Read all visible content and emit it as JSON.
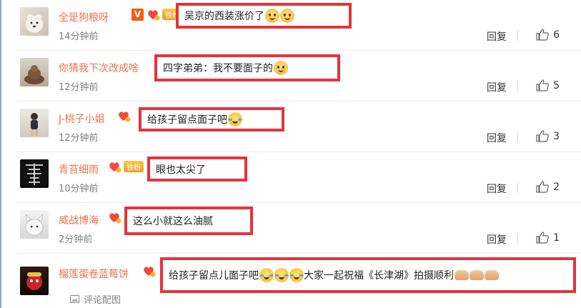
{
  "ui": {
    "reply_label": "回复",
    "comment_with_pic_label": "评论配图",
    "accent_name_color": "#eb7350",
    "highlight_color": "#e5333b"
  },
  "comments": [
    {
      "name": "全是狗粮呀",
      "badges": [
        "V",
        "heart",
        "铁粉"
      ],
      "time": "14分钟前",
      "text": "吴京的西装涨价了",
      "emojis": [
        "shy",
        "shy"
      ],
      "likes": "6"
    },
    {
      "name": "你猜我下次改成啥",
      "badges": [],
      "time": "12分钟前",
      "text": "四字弟弟：我不要面子的",
      "emojis": [
        "shy"
      ],
      "likes": "5"
    },
    {
      "name": "J-桃子小姐",
      "badges": [
        "heart"
      ],
      "time": "12分钟前",
      "text": "给孩子留点面子吧",
      "emojis": [
        "laugh"
      ],
      "likes": "3"
    },
    {
      "name": "青苔细雨",
      "badges": [
        "heart",
        "铁粉"
      ],
      "time": "10分钟前",
      "text": "眼也太尖了",
      "emojis": [],
      "likes": "2"
    },
    {
      "name": "威战博海",
      "badges": [
        "heart"
      ],
      "time": "2分钟前",
      "text": "这么小就这么油腻",
      "emojis": [],
      "likes": "1"
    },
    {
      "name": "榴莲蛋卷蓝莓饼",
      "badges": [
        "heart"
      ],
      "time": "",
      "text": "给孩子留点儿面子吧",
      "emojis": [
        "laugh",
        "laugh",
        "laugh"
      ],
      "text2": "大家一起祝福《长津湖》拍摄顺利",
      "emojis2": [
        "strong",
        "strong",
        "strong"
      ],
      "likes": ""
    }
  ]
}
